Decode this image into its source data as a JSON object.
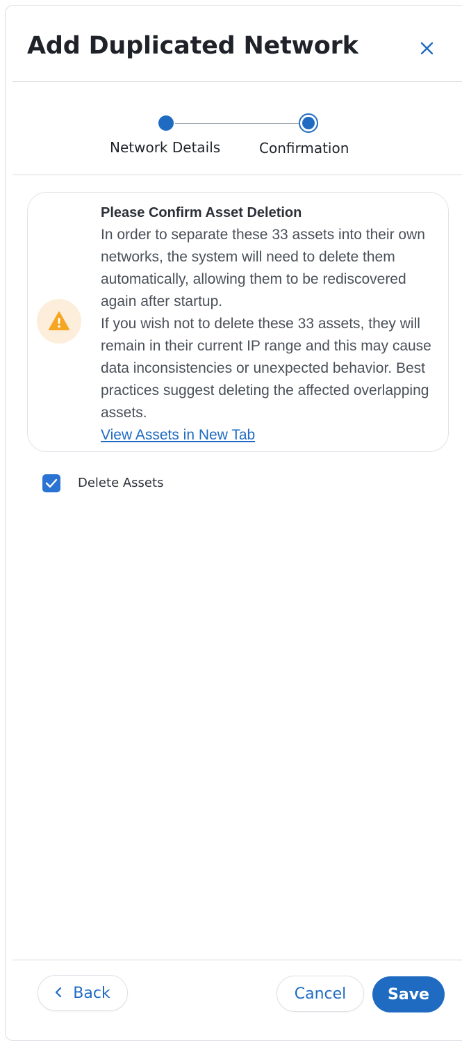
{
  "dialog": {
    "title": "Add Duplicated Network",
    "close_icon": "close-icon"
  },
  "stepper": {
    "steps": [
      {
        "label": "Network Details",
        "state": "completed"
      },
      {
        "label": "Confirmation",
        "state": "current"
      }
    ]
  },
  "alert": {
    "icon": "warning-icon",
    "title": "Please Confirm Asset Deletion",
    "paragraph1": "In order to separate these 33 assets into their own networks, the system will need to delete them automatically, allowing them to be rediscovered again after startup.",
    "paragraph2": "If you wish not to delete these 33 assets, they will remain in their current IP range and this may cause data inconsistencies or unexpected behavior. Best practices suggest deleting the affected overlapping assets.",
    "link_text": "View Assets in New Tab"
  },
  "delete_assets": {
    "label": "Delete Assets",
    "checked": true
  },
  "footer": {
    "back_label": "Back",
    "cancel_label": "Cancel",
    "save_label": "Save"
  },
  "colors": {
    "primary": "#1f6bc1",
    "warning": "#f5a623",
    "warning_bg": "#fdeedb",
    "checkbox": "#2b73d2"
  }
}
